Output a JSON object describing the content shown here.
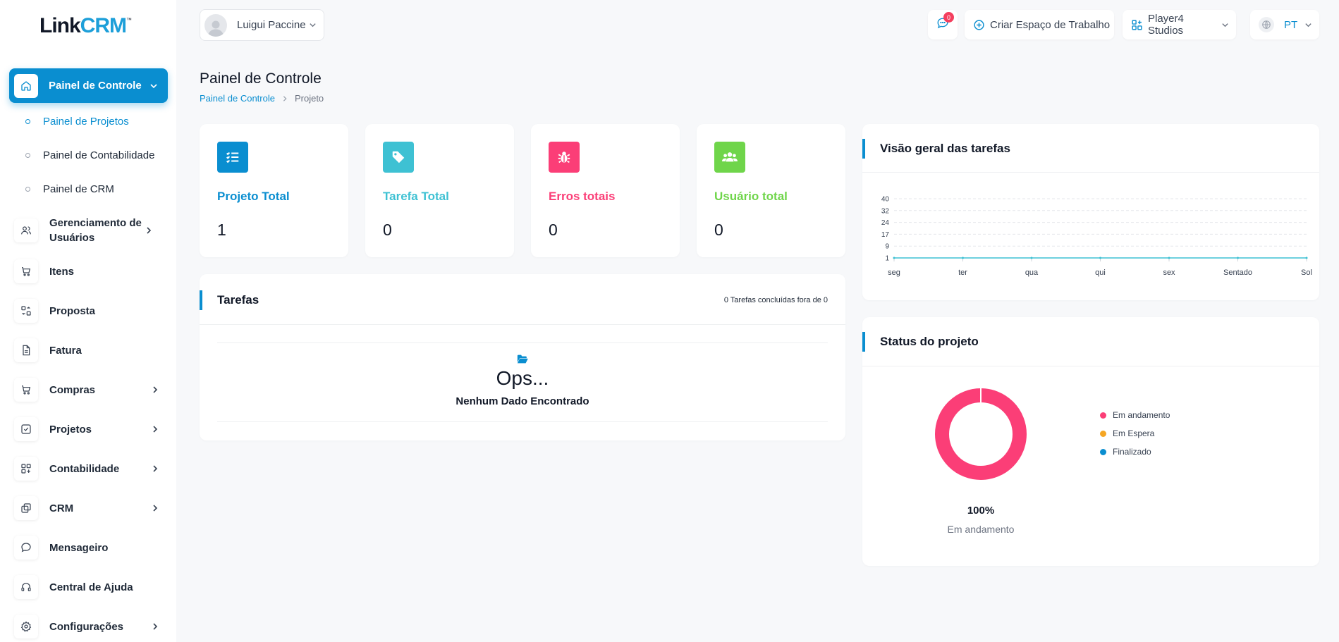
{
  "app": {
    "logo_main": "Link",
    "logo_accent": "CRM",
    "logo_mark": "™"
  },
  "sidebar": {
    "active": {
      "label": "Painel de Controle",
      "icon": "home-icon"
    },
    "sub_items": [
      {
        "label": "Painel de Projetos",
        "active": true
      },
      {
        "label": "Painel de Contabilidade",
        "active": false
      },
      {
        "label": "Painel de CRM",
        "active": false
      }
    ],
    "items": [
      {
        "label": "Gerenciamento de Usuários",
        "icon": "users-icon",
        "has_children": true
      },
      {
        "label": "Itens",
        "icon": "cart-icon",
        "has_children": false
      },
      {
        "label": "Proposta",
        "icon": "proposal-icon",
        "has_children": false
      },
      {
        "label": "Fatura",
        "icon": "invoice-icon",
        "has_children": false
      },
      {
        "label": "Compras",
        "icon": "cart-icon",
        "has_children": true
      },
      {
        "label": "Projetos",
        "icon": "check-square-icon",
        "has_children": true
      },
      {
        "label": "Contabilidade",
        "icon": "grid-plus-icon",
        "has_children": true
      },
      {
        "label": "CRM",
        "icon": "layers-icon",
        "has_children": true
      },
      {
        "label": "Mensageiro",
        "icon": "chat-icon",
        "has_children": false
      },
      {
        "label": "Central de Ajuda",
        "icon": "headphones-icon",
        "has_children": false
      },
      {
        "label": "Configurações",
        "icon": "gear-icon",
        "has_children": true
      }
    ]
  },
  "topbar": {
    "user_name": "Luigui Paccine",
    "messages_badge": "0",
    "create_workspace": "Criar Espaço de Trabalho",
    "workspace": "Player4 Studios",
    "language": "PT"
  },
  "page": {
    "title": "Painel de Controle",
    "breadcrumb": [
      "Painel de Controle",
      "Projeto"
    ]
  },
  "stats": [
    {
      "title": "Projeto Total",
      "value": "1",
      "color": "#0a8ed0",
      "icon": "list-check-icon"
    },
    {
      "title": "Tarefa Total",
      "value": "0",
      "color": "#3ec1d3",
      "icon": "tag-icon"
    },
    {
      "title": "Erros totais",
      "value": "0",
      "color": "#fb3e77",
      "icon": "bug-icon"
    },
    {
      "title": "Usuário total",
      "value": "0",
      "color": "#6fd54a",
      "icon": "users-group-icon"
    }
  ],
  "tasks": {
    "title": "Tarefas",
    "summary": "0 Tarefas concluídas fora de 0",
    "empty_title": "Ops...",
    "empty_text": "Nenhum Dado Encontrado"
  },
  "overview": {
    "title": "Visão geral das tarefas"
  },
  "chart_data": [
    {
      "type": "line",
      "categories": [
        "seg",
        "ter",
        "qua",
        "qui",
        "sex",
        "Sentado",
        "Sol"
      ],
      "series": [
        {
          "values": [
            0,
            0,
            0,
            0,
            0,
            0,
            0
          ]
        }
      ],
      "yticks": [
        "40",
        "32",
        "24",
        "17",
        "9",
        "1"
      ],
      "grid": true,
      "color": "#3ec1d3"
    },
    {
      "type": "pie",
      "categories": [
        "Em andamento",
        "Em Espera",
        "Finalizado"
      ],
      "values": [
        100,
        0,
        0
      ],
      "colors": [
        "#fb3e77",
        "#f5a623",
        "#0a8ed0"
      ],
      "center_value": "100%",
      "center_label": "Em andamento",
      "legend": "right"
    }
  ],
  "status": {
    "title": "Status do projeto"
  }
}
